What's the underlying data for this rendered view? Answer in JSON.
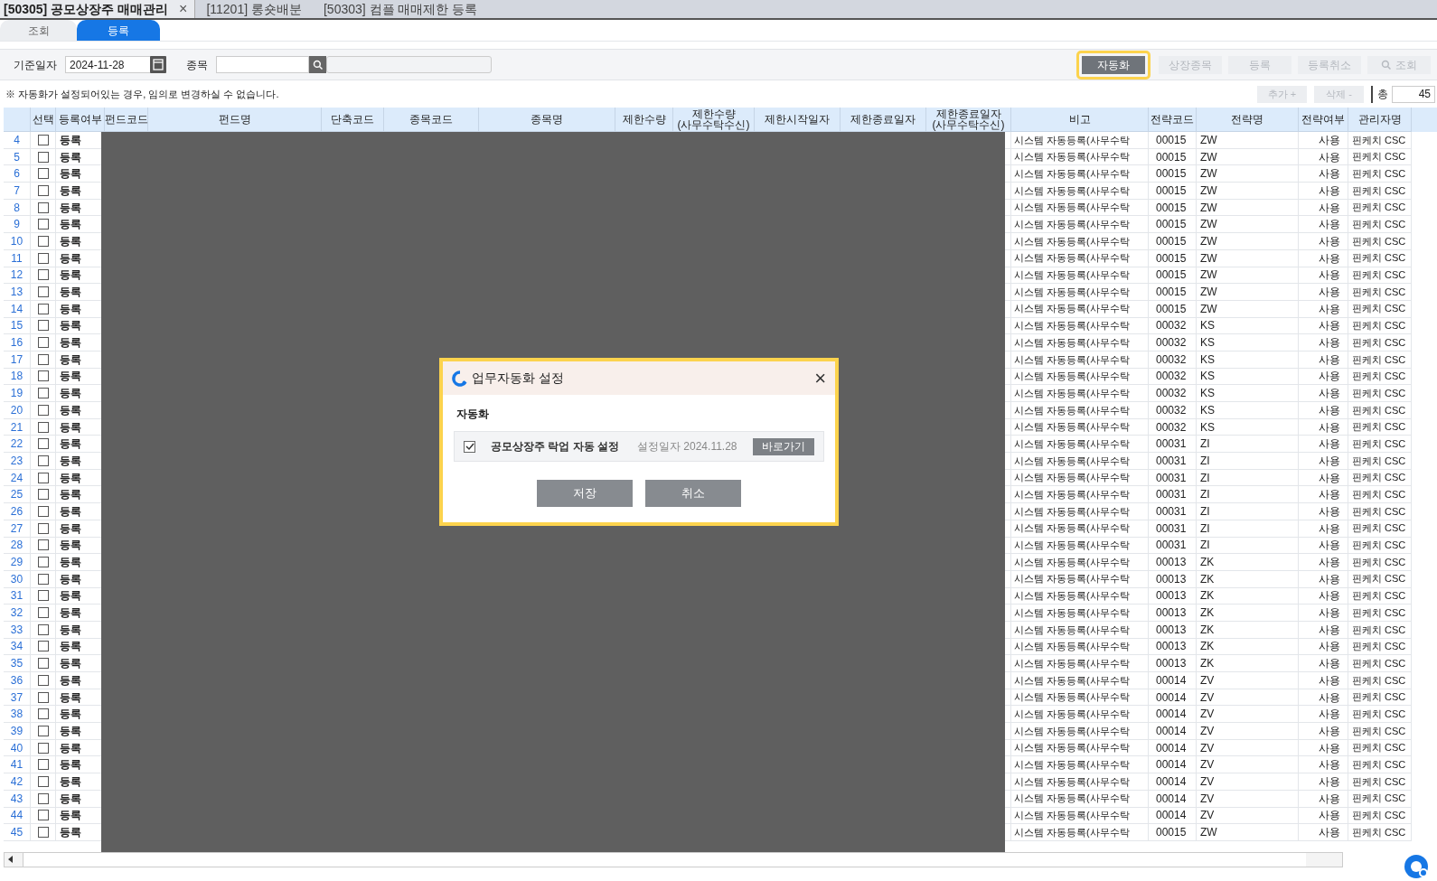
{
  "tabs": [
    {
      "label": "[50305] 공모상장주 매매관리",
      "selected": true,
      "close": "×"
    },
    {
      "label": "[11201] 롱숏배분",
      "selected": false
    },
    {
      "label": "[50303] 컴플 매매제한 등록",
      "selected": false
    }
  ],
  "subtabs": [
    {
      "label": "조회",
      "selected": false
    },
    {
      "label": "등록",
      "selected": true
    }
  ],
  "filters": {
    "date_label": "기준일자",
    "date_value": "2024-11-28",
    "item_label": "종목"
  },
  "toolbar": [
    {
      "label": "자동화",
      "disabled": false,
      "highlighted": true,
      "kind": "plain"
    },
    {
      "label": "상장종목",
      "disabled": true,
      "highlighted": false,
      "kind": "plain"
    },
    {
      "label": "등록",
      "disabled": true,
      "highlighted": false,
      "kind": "plain"
    },
    {
      "label": "등록취소",
      "disabled": true,
      "highlighted": false,
      "kind": "plain"
    },
    {
      "label": "조회",
      "disabled": true,
      "highlighted": false,
      "kind": "search"
    }
  ],
  "notice": "※ 자동화가 설정되어있는 경우, 임의로 변경하실 수 없습니다.",
  "row_actions": [
    {
      "label": "추가 +",
      "disabled": true
    },
    {
      "label": "삭제 -",
      "disabled": true
    }
  ],
  "total": {
    "label": "총",
    "value": "45"
  },
  "table": {
    "columns": [
      {},
      {
        "lines": [
          "선택"
        ]
      },
      {
        "lines": [
          "등록여부"
        ]
      },
      {
        "lines": [
          "펀드코드"
        ]
      },
      {
        "lines": [
          "펀드명"
        ]
      },
      {
        "lines": [
          "단축코드"
        ]
      },
      {
        "lines": [
          "종목코드"
        ]
      },
      {
        "lines": [
          "종목명"
        ]
      },
      {
        "lines": [
          "제한수량"
        ]
      },
      {
        "lines": [
          "제한수량",
          "(사무수탁수신)"
        ]
      },
      {
        "lines": [
          "제한시작일자"
        ]
      },
      {
        "lines": [
          "제한종료일자"
        ]
      },
      {
        "lines": [
          "제한종료일자",
          "(사무수탁수신)"
        ]
      },
      {
        "lines": [
          "비고"
        ]
      },
      {
        "lines": [
          "전략코드"
        ]
      },
      {
        "lines": [
          "전략명"
        ]
      },
      {
        "lines": [
          "전략여부"
        ]
      },
      {
        "lines": [
          "관리자명"
        ]
      }
    ],
    "rows": [
      {
        "no": "4",
        "checked": false,
        "status": "등록",
        "note": "시스템 자동등록(사무수탁",
        "strategy_code": "00015",
        "strategy": "ZW",
        "use": "사용",
        "manager": "핀케치 CSC"
      },
      {
        "no": "5",
        "checked": false,
        "status": "등록",
        "note": "시스템 자동등록(사무수탁",
        "strategy_code": "00015",
        "strategy": "ZW",
        "use": "사용",
        "manager": "핀케치 CSC"
      },
      {
        "no": "6",
        "checked": false,
        "status": "등록",
        "note": "시스템 자동등록(사무수탁",
        "strategy_code": "00015",
        "strategy": "ZW",
        "use": "사용",
        "manager": "핀케치 CSC"
      },
      {
        "no": "7",
        "checked": false,
        "status": "등록",
        "note": "시스템 자동등록(사무수탁",
        "strategy_code": "00015",
        "strategy": "ZW",
        "use": "사용",
        "manager": "핀케치 CSC"
      },
      {
        "no": "8",
        "checked": false,
        "status": "등록",
        "note": "시스템 자동등록(사무수탁",
        "strategy_code": "00015",
        "strategy": "ZW",
        "use": "사용",
        "manager": "핀케치 CSC"
      },
      {
        "no": "9",
        "checked": false,
        "status": "등록",
        "note": "시스템 자동등록(사무수탁",
        "strategy_code": "00015",
        "strategy": "ZW",
        "use": "사용",
        "manager": "핀케치 CSC"
      },
      {
        "no": "10",
        "checked": false,
        "status": "등록",
        "note": "시스템 자동등록(사무수탁",
        "strategy_code": "00015",
        "strategy": "ZW",
        "use": "사용",
        "manager": "핀케치 CSC"
      },
      {
        "no": "11",
        "checked": false,
        "status": "등록",
        "note": "시스템 자동등록(사무수탁",
        "strategy_code": "00015",
        "strategy": "ZW",
        "use": "사용",
        "manager": "핀케치 CSC"
      },
      {
        "no": "12",
        "checked": false,
        "status": "등록",
        "note": "시스템 자동등록(사무수탁",
        "strategy_code": "00015",
        "strategy": "ZW",
        "use": "사용",
        "manager": "핀케치 CSC"
      },
      {
        "no": "13",
        "checked": false,
        "status": "등록",
        "note": "시스템 자동등록(사무수탁",
        "strategy_code": "00015",
        "strategy": "ZW",
        "use": "사용",
        "manager": "핀케치 CSC"
      },
      {
        "no": "14",
        "checked": false,
        "status": "등록",
        "note": "시스템 자동등록(사무수탁",
        "strategy_code": "00015",
        "strategy": "ZW",
        "use": "사용",
        "manager": "핀케치 CSC"
      },
      {
        "no": "15",
        "checked": false,
        "status": "등록",
        "note": "시스템 자동등록(사무수탁",
        "strategy_code": "00032",
        "strategy": "KS",
        "use": "사용",
        "manager": "핀케치 CSC"
      },
      {
        "no": "16",
        "checked": false,
        "status": "등록",
        "note": "시스템 자동등록(사무수탁",
        "strategy_code": "00032",
        "strategy": "KS",
        "use": "사용",
        "manager": "핀케치 CSC"
      },
      {
        "no": "17",
        "checked": false,
        "status": "등록",
        "note": "시스템 자동등록(사무수탁",
        "strategy_code": "00032",
        "strategy": "KS",
        "use": "사용",
        "manager": "핀케치 CSC"
      },
      {
        "no": "18",
        "checked": false,
        "status": "등록",
        "note": "시스템 자동등록(사무수탁",
        "strategy_code": "00032",
        "strategy": "KS",
        "use": "사용",
        "manager": "핀케치 CSC"
      },
      {
        "no": "19",
        "checked": false,
        "status": "등록",
        "note": "시스템 자동등록(사무수탁",
        "strategy_code": "00032",
        "strategy": "KS",
        "use": "사용",
        "manager": "핀케치 CSC"
      },
      {
        "no": "20",
        "checked": false,
        "status": "등록",
        "note": "시스템 자동등록(사무수탁",
        "strategy_code": "00032",
        "strategy": "KS",
        "use": "사용",
        "manager": "핀케치 CSC"
      },
      {
        "no": "21",
        "checked": false,
        "status": "등록",
        "note": "시스템 자동등록(사무수탁",
        "strategy_code": "00032",
        "strategy": "KS",
        "use": "사용",
        "manager": "핀케치 CSC"
      },
      {
        "no": "22",
        "checked": false,
        "status": "등록",
        "note": "시스템 자동등록(사무수탁",
        "strategy_code": "00031",
        "strategy": "ZI",
        "use": "사용",
        "manager": "핀케치 CSC"
      },
      {
        "no": "23",
        "checked": false,
        "status": "등록",
        "note": "시스템 자동등록(사무수탁",
        "strategy_code": "00031",
        "strategy": "ZI",
        "use": "사용",
        "manager": "핀케치 CSC"
      },
      {
        "no": "24",
        "checked": false,
        "status": "등록",
        "note": "시스템 자동등록(사무수탁",
        "strategy_code": "00031",
        "strategy": "ZI",
        "use": "사용",
        "manager": "핀케치 CSC"
      },
      {
        "no": "25",
        "checked": false,
        "status": "등록",
        "note": "시스템 자동등록(사무수탁",
        "strategy_code": "00031",
        "strategy": "ZI",
        "use": "사용",
        "manager": "핀케치 CSC"
      },
      {
        "no": "26",
        "checked": false,
        "status": "등록",
        "note": "시스템 자동등록(사무수탁",
        "strategy_code": "00031",
        "strategy": "ZI",
        "use": "사용",
        "manager": "핀케치 CSC"
      },
      {
        "no": "27",
        "checked": false,
        "status": "등록",
        "note": "시스템 자동등록(사무수탁",
        "strategy_code": "00031",
        "strategy": "ZI",
        "use": "사용",
        "manager": "핀케치 CSC"
      },
      {
        "no": "28",
        "checked": false,
        "status": "등록",
        "note": "시스템 자동등록(사무수탁",
        "strategy_code": "00031",
        "strategy": "ZI",
        "use": "사용",
        "manager": "핀케치 CSC"
      },
      {
        "no": "29",
        "checked": false,
        "status": "등록",
        "note": "시스템 자동등록(사무수탁",
        "strategy_code": "00013",
        "strategy": "ZK",
        "use": "사용",
        "manager": "핀케치 CSC"
      },
      {
        "no": "30",
        "checked": false,
        "status": "등록",
        "note": "시스템 자동등록(사무수탁",
        "strategy_code": "00013",
        "strategy": "ZK",
        "use": "사용",
        "manager": "핀케치 CSC"
      },
      {
        "no": "31",
        "checked": false,
        "status": "등록",
        "note": "시스템 자동등록(사무수탁",
        "strategy_code": "00013",
        "strategy": "ZK",
        "use": "사용",
        "manager": "핀케치 CSC"
      },
      {
        "no": "32",
        "checked": false,
        "status": "등록",
        "note": "시스템 자동등록(사무수탁",
        "strategy_code": "00013",
        "strategy": "ZK",
        "use": "사용",
        "manager": "핀케치 CSC"
      },
      {
        "no": "33",
        "checked": false,
        "status": "등록",
        "note": "시스템 자동등록(사무수탁",
        "strategy_code": "00013",
        "strategy": "ZK",
        "use": "사용",
        "manager": "핀케치 CSC"
      },
      {
        "no": "34",
        "checked": false,
        "status": "등록",
        "note": "시스템 자동등록(사무수탁",
        "strategy_code": "00013",
        "strategy": "ZK",
        "use": "사용",
        "manager": "핀케치 CSC"
      },
      {
        "no": "35",
        "checked": false,
        "status": "등록",
        "note": "시스템 자동등록(사무수탁",
        "strategy_code": "00013",
        "strategy": "ZK",
        "use": "사용",
        "manager": "핀케치 CSC"
      },
      {
        "no": "36",
        "checked": false,
        "status": "등록",
        "note": "시스템 자동등록(사무수탁",
        "strategy_code": "00014",
        "strategy": "ZV",
        "use": "사용",
        "manager": "핀케치 CSC"
      },
      {
        "no": "37",
        "checked": false,
        "status": "등록",
        "note": "시스템 자동등록(사무수탁",
        "strategy_code": "00014",
        "strategy": "ZV",
        "use": "사용",
        "manager": "핀케치 CSC"
      },
      {
        "no": "38",
        "checked": false,
        "status": "등록",
        "note": "시스템 자동등록(사무수탁",
        "strategy_code": "00014",
        "strategy": "ZV",
        "use": "사용",
        "manager": "핀케치 CSC"
      },
      {
        "no": "39",
        "checked": false,
        "status": "등록",
        "note": "시스템 자동등록(사무수탁",
        "strategy_code": "00014",
        "strategy": "ZV",
        "use": "사용",
        "manager": "핀케치 CSC"
      },
      {
        "no": "40",
        "checked": false,
        "status": "등록",
        "note": "시스템 자동등록(사무수탁",
        "strategy_code": "00014",
        "strategy": "ZV",
        "use": "사용",
        "manager": "핀케치 CSC"
      },
      {
        "no": "41",
        "checked": false,
        "status": "등록",
        "note": "시스템 자동등록(사무수탁",
        "strategy_code": "00014",
        "strategy": "ZV",
        "use": "사용",
        "manager": "핀케치 CSC"
      },
      {
        "no": "42",
        "checked": false,
        "status": "등록",
        "note": "시스템 자동등록(사무수탁",
        "strategy_code": "00014",
        "strategy": "ZV",
        "use": "사용",
        "manager": "핀케치 CSC"
      },
      {
        "no": "43",
        "checked": false,
        "status": "등록",
        "note": "시스템 자동등록(사무수탁",
        "strategy_code": "00014",
        "strategy": "ZV",
        "use": "사용",
        "manager": "핀케치 CSC"
      },
      {
        "no": "44",
        "checked": false,
        "status": "등록",
        "note": "시스템 자동등록(사무수탁",
        "strategy_code": "00014",
        "strategy": "ZV",
        "use": "사용",
        "manager": "핀케치 CSC"
      },
      {
        "no": "45",
        "checked": false,
        "status": "등록",
        "note": "시스템 자동등록(사무수탁",
        "strategy_code": "00015",
        "strategy": "ZW",
        "use": "사용",
        "manager": "핀케치 CSC"
      }
    ]
  },
  "dialog": {
    "title": "업무자동화 설정",
    "close": "×",
    "section": "자동화",
    "items": [
      {
        "label": "공모상장주 락업 자동 설정",
        "checked": true,
        "date": "설정일자 2024.11.28",
        "action": "바로가기"
      }
    ],
    "buttons": [
      "저장",
      "취소"
    ]
  }
}
